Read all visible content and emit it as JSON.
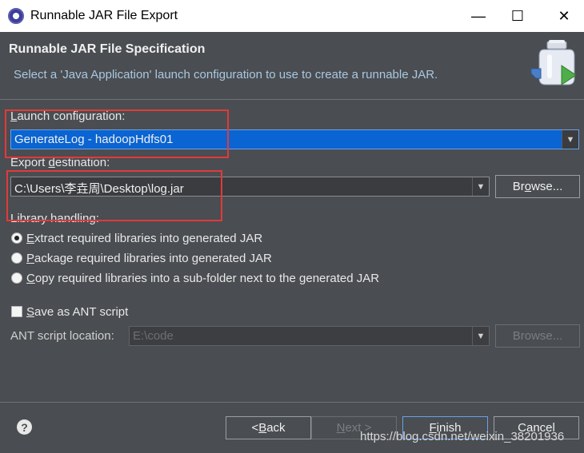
{
  "window": {
    "title": "Runnable JAR File Export",
    "minimize": "—",
    "maximize": "☐",
    "close": "✕"
  },
  "header": {
    "title": "Runnable JAR File Specification",
    "description": "Select a 'Java Application' launch configuration to use to create a runnable JAR."
  },
  "launch": {
    "label_u": "L",
    "label_rest": "aunch configuration:",
    "value": "GenerateLog - hadoopHdfs01"
  },
  "export": {
    "label_pre": "Export ",
    "label_u": "d",
    "label_rest": "estination:",
    "value": "C:\\Users\\李垚周\\Desktop\\log.jar",
    "browse_u": "o",
    "browse_pre": "Br",
    "browse_rest": "wse..."
  },
  "library": {
    "label": "Library handling:",
    "options": [
      {
        "u": "E",
        "rest": "xtract required libraries into generated JAR",
        "checked": true
      },
      {
        "u": "P",
        "rest": "ackage required libraries into generated JAR",
        "checked": false
      },
      {
        "u": "C",
        "rest": "opy required libraries into a sub-folder next to the generated JAR",
        "checked": false
      }
    ]
  },
  "ant": {
    "save_u": "S",
    "save_rest": "ave as ANT script",
    "location_label": "ANT script location:",
    "location_value": "E:\\code",
    "browse_label": "Browse..."
  },
  "footer": {
    "help": "?",
    "back_pre": "< ",
    "back_u": "B",
    "back_rest": "ack",
    "next_u": "N",
    "next_rest": "ext >",
    "finish_u": "F",
    "finish_rest": "inish",
    "cancel": "Cancel"
  },
  "watermark": "https://blog.csdn.net/weixin_38201936",
  "colors": {
    "background": "#4a4d51",
    "selection": "#0a64d2",
    "annotation": "#e23a3a"
  }
}
